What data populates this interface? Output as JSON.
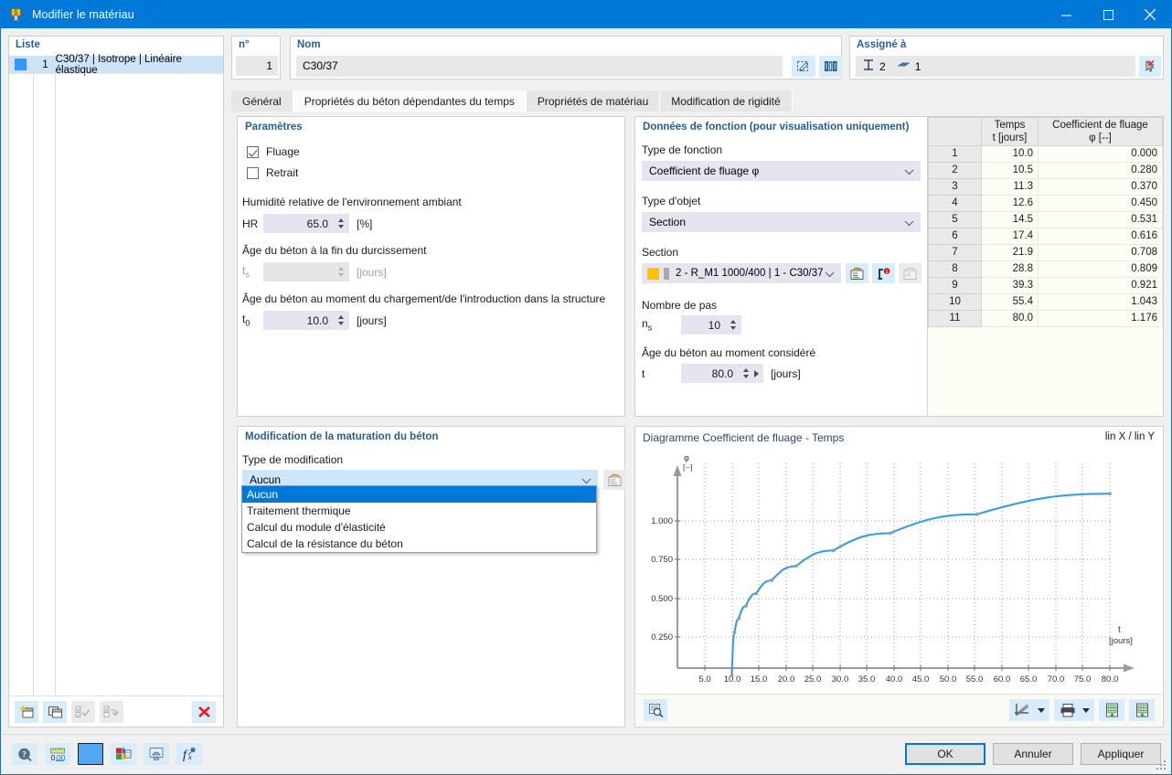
{
  "window": {
    "title": "Modifier le matériau",
    "minimize_label": "–",
    "maximize_label": "□",
    "close_label": "✕"
  },
  "left_panel": {
    "header": "Liste",
    "rows": [
      {
        "num": "1",
        "label": "C30/37 | Isotrope | Linéaire élastique"
      }
    ],
    "toolbar": [
      {
        "name": "new-material-button"
      },
      {
        "name": "copy-material-button"
      },
      {
        "name": "select-all-button"
      },
      {
        "name": "invert-selection-button"
      },
      {
        "name": "delete-material-button"
      }
    ]
  },
  "identity": {
    "number_label": "n°",
    "number_value": "1",
    "name_label": "Nom",
    "name_value": "C30/37",
    "edit_button": "edit-material-icon",
    "library_button": "material-library-icon"
  },
  "assigned": {
    "title": "Assigné à",
    "members_count": "2",
    "surfaces_count": "1",
    "pick_button": "pick-object-icon"
  },
  "tabs": [
    {
      "label": "Général",
      "active": false
    },
    {
      "label": "Propriétés du béton dépendantes du temps",
      "active": true
    },
    {
      "label": "Propriétés de matériau",
      "active": false
    },
    {
      "label": "Modification de rigidité",
      "active": false
    }
  ],
  "parameters": {
    "title": "Paramètres",
    "creep": {
      "label": "Fluage",
      "checked": true
    },
    "shrinkage": {
      "label": "Retrait",
      "checked": false
    },
    "humidity": {
      "label": "Humidité relative de l'environnement ambiant",
      "symbol": "HR",
      "value": "65.0",
      "unit": "[%]"
    },
    "hardening_age": {
      "label": "Âge du béton à la fin du durcissement",
      "symbol": "t",
      "symbol_sub": "s",
      "value": "",
      "unit": "[jours]",
      "disabled": true
    },
    "loading_age": {
      "label": "Âge du béton au moment du chargement/de l'introduction dans la structure",
      "symbol": "t",
      "symbol_sub": "0",
      "value": "10.0",
      "unit": "[jours]"
    }
  },
  "function_data": {
    "title": "Données de fonction (pour visualisation uniquement)",
    "function_type": {
      "label": "Type de fonction",
      "value": "Coefficient de fluage φ"
    },
    "object_type": {
      "label": "Type d'objet",
      "value": "Section"
    },
    "section": {
      "label": "Section",
      "value": "2 - R_M1 1000/400 | 1 - C30/37",
      "buttons": [
        "section-properties-icon",
        "section-info-icon",
        "section-new-icon"
      ]
    },
    "steps": {
      "label": "Nombre de pas",
      "symbol": "n",
      "symbol_sub": "s",
      "value": "10"
    },
    "considered_age": {
      "label": "Âge du béton au moment considéré",
      "symbol": "t",
      "value": "80.0",
      "unit": "[jours]"
    }
  },
  "maturity": {
    "title": "Modification de la maturation du béton",
    "type_label": "Type de modification",
    "selected": "Aucun",
    "options": [
      "Aucun",
      "Traitement thermique",
      "Calcul du module d'élasticité",
      "Calcul de la résistance du béton"
    ],
    "side_button": "maturity-settings-icon"
  },
  "table": {
    "headers": [
      "",
      "Temps\nt [jours]",
      "Coefficient de fluage\nφ [--]"
    ],
    "header_time_line1": "Temps",
    "header_time_line2": "t [jours]",
    "header_creep_line1": "Coefficient de fluage",
    "header_creep_line2": "φ [--]",
    "rows": [
      {
        "idx": "1",
        "t": "10.0",
        "phi": "0.000"
      },
      {
        "idx": "2",
        "t": "10.5",
        "phi": "0.280"
      },
      {
        "idx": "3",
        "t": "11.3",
        "phi": "0.370"
      },
      {
        "idx": "4",
        "t": "12.6",
        "phi": "0.450"
      },
      {
        "idx": "5",
        "t": "14.5",
        "phi": "0.531"
      },
      {
        "idx": "6",
        "t": "17.4",
        "phi": "0.616"
      },
      {
        "idx": "7",
        "t": "21.9",
        "phi": "0.708"
      },
      {
        "idx": "8",
        "t": "28.8",
        "phi": "0.809"
      },
      {
        "idx": "9",
        "t": "39.3",
        "phi": "0.921"
      },
      {
        "idx": "10",
        "t": "55.4",
        "phi": "1.043"
      },
      {
        "idx": "11",
        "t": "80.0",
        "phi": "1.176"
      }
    ]
  },
  "chart_panel": {
    "title": "Diagramme Coefficient de fluage - Temps",
    "scale_note": "lin X / lin Y",
    "zoom_button": "chart-zoom-icon",
    "right_buttons": [
      "chart-style-icon",
      "chart-style-dropdown",
      "print-icon",
      "print-dropdown",
      "export-excel-icon",
      "export-excel-table-icon"
    ]
  },
  "chart_data": {
    "type": "line",
    "title": "Diagramme Coefficient de fluage - Temps",
    "xlabel": "t",
    "xunit": "[jours]",
    "ylabel": "φ",
    "yunit": "[--]",
    "xlim": [
      0,
      84
    ],
    "ylim": [
      0,
      1.32
    ],
    "xticks": [
      5.0,
      10.0,
      15.0,
      20.0,
      25.0,
      30.0,
      35.0,
      40.0,
      45.0,
      50.0,
      55.0,
      60.0,
      65.0,
      70.0,
      75.0,
      80.0
    ],
    "xticklabels": [
      "5.0",
      "10.0",
      "15.0",
      "20.0",
      "25.0",
      "30.0",
      "35.0",
      "40.0",
      "45.0",
      "50.0",
      "55.0",
      "60.0",
      "65.0",
      "70.0",
      "75.0",
      "80.0"
    ],
    "yticks": [
      0.25,
      0.5,
      0.75,
      1.0
    ],
    "yticklabels": [
      "0.250",
      "0.500",
      "0.750",
      "1.000"
    ],
    "grid": true,
    "legend": false,
    "series": [
      {
        "name": "Coefficient de fluage φ",
        "color": "#3a9de0",
        "x": [
          10.0,
          10.5,
          11.3,
          12.6,
          14.5,
          17.4,
          21.9,
          28.8,
          39.3,
          55.4,
          80.0
        ],
        "y": [
          0.0,
          0.28,
          0.37,
          0.45,
          0.531,
          0.616,
          0.708,
          0.809,
          0.921,
          1.043,
          1.176
        ]
      }
    ]
  },
  "footer": {
    "buttons": [
      {
        "name": "help-button"
      },
      {
        "name": "units-button"
      },
      {
        "name": "color-swatch-button"
      },
      {
        "name": "display-properties-button"
      },
      {
        "name": "view-button"
      },
      {
        "name": "formula-button"
      }
    ],
    "ok": "OK",
    "cancel": "Annuler",
    "apply": "Appliquer"
  }
}
